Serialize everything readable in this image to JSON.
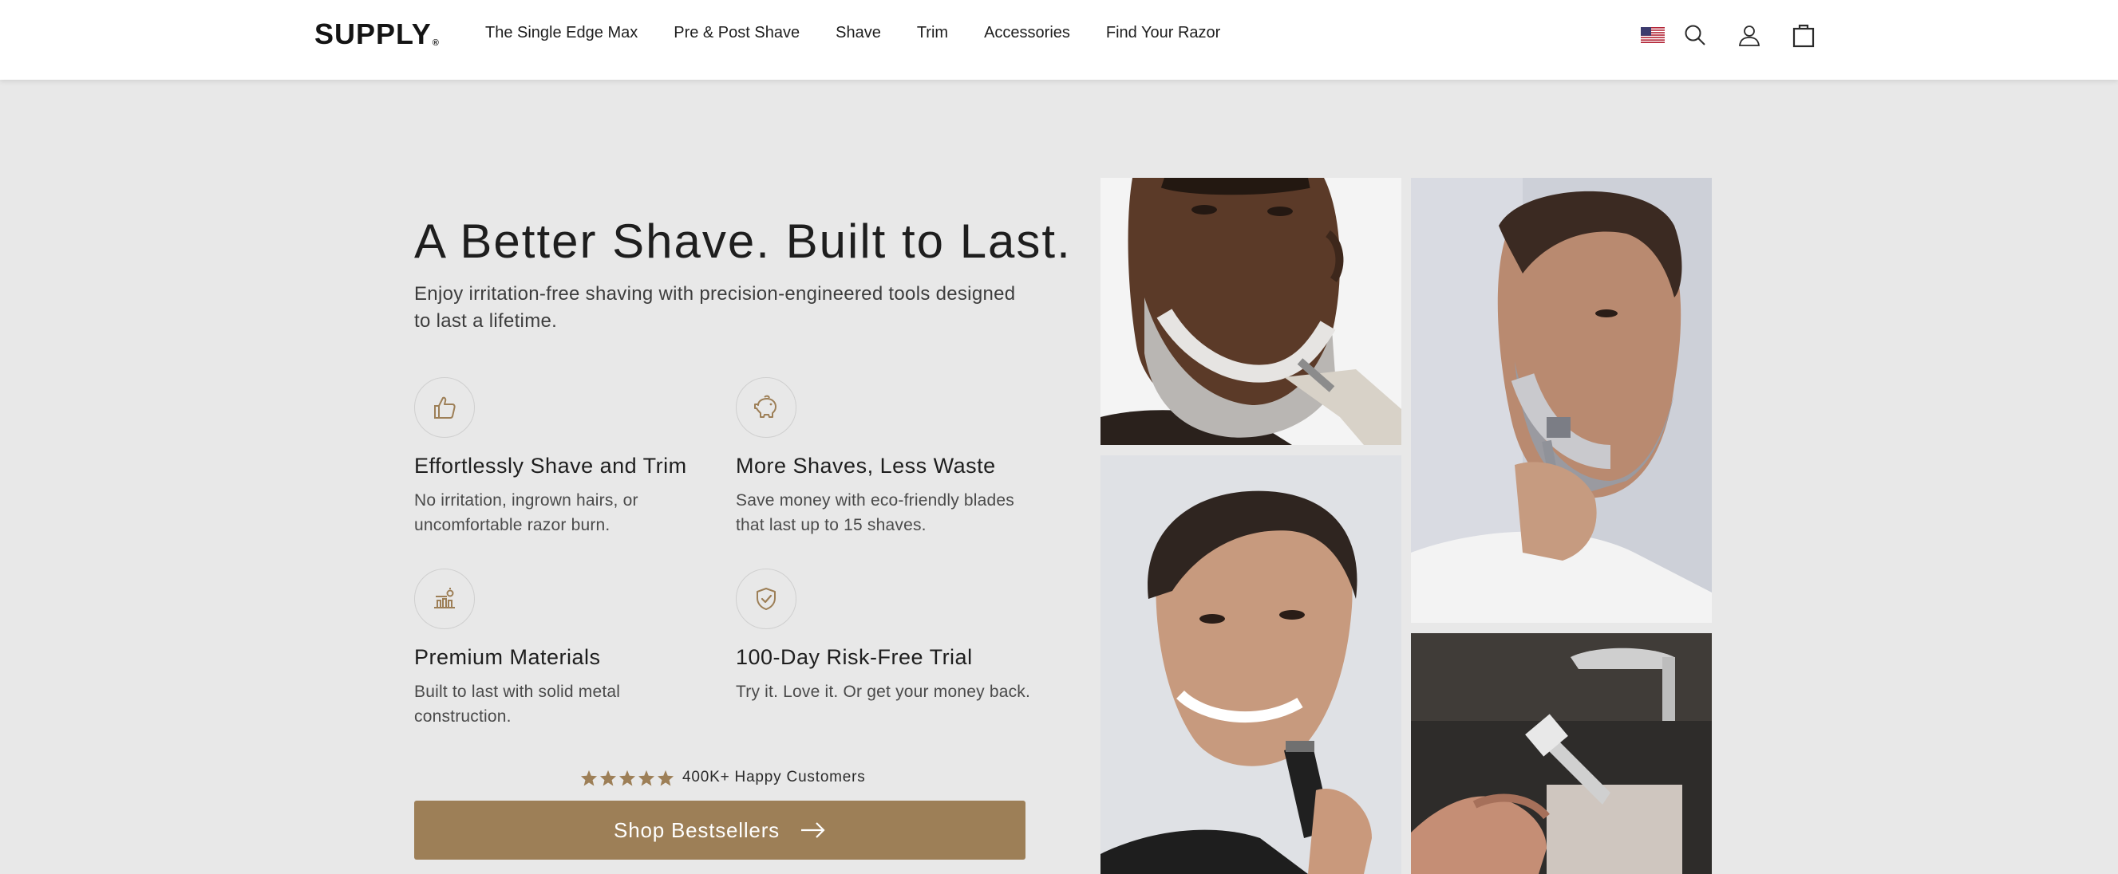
{
  "header": {
    "logo": "SUPPLY",
    "logo_mark": "®",
    "nav": [
      "The Single Edge Max",
      "Pre & Post Shave",
      "Shave",
      "Trim",
      "Accessories",
      "Find Your Razor"
    ],
    "icons": [
      "us-flag-icon",
      "search-icon",
      "user-icon",
      "cart-icon"
    ]
  },
  "hero": {
    "title": "A Better Shave. Built to Last.",
    "subtitle": "Enjoy irritation-free shaving with precision-engineered tools designed to last a lifetime."
  },
  "features": [
    {
      "icon": "thumbs-up-icon",
      "title": "Effortlessly Shave and Trim",
      "desc": "No irritation, ingrown hairs, or uncomfortable razor burn."
    },
    {
      "icon": "piggy-bank-icon",
      "title": "More Shaves, Less Waste",
      "desc": "Save money with eco-friendly blades that last up to 15 shaves."
    },
    {
      "icon": "materials-icon",
      "title": "Premium Materials",
      "desc": "Built to last with solid metal construction."
    },
    {
      "icon": "shield-check-icon",
      "title": "100-Day Risk-Free Trial",
      "desc": "Try it. Love it. Or get your money back."
    }
  ],
  "rating": {
    "stars": 5,
    "text": "400K+ Happy Customers"
  },
  "cta": {
    "label": "Shop Bestsellers"
  },
  "colors": {
    "accent": "#9d7f57",
    "background": "#e8e8e8",
    "header": "#ffffff",
    "text": "#1e1e1e"
  }
}
